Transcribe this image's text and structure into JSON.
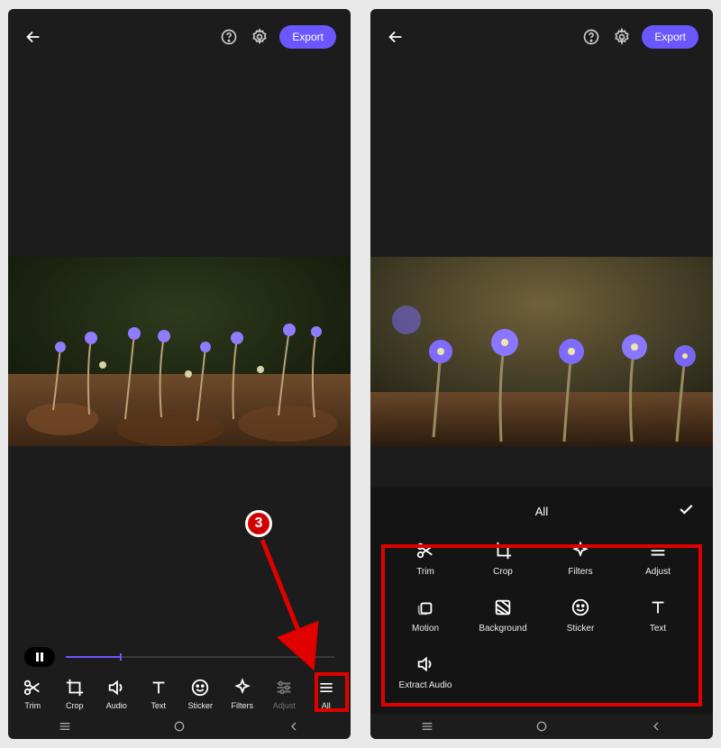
{
  "header": {
    "export_label": "Export"
  },
  "left": {
    "tools": [
      {
        "name": "trim",
        "label": "Trim"
      },
      {
        "name": "crop",
        "label": "Crop"
      },
      {
        "name": "audio",
        "label": "Audio"
      },
      {
        "name": "text",
        "label": "Text"
      },
      {
        "name": "sticker",
        "label": "Sticker"
      },
      {
        "name": "filters",
        "label": "Filters"
      },
      {
        "name": "adjust",
        "label": "Adjust"
      },
      {
        "name": "all",
        "label": "All"
      }
    ]
  },
  "right": {
    "panel_title": "All",
    "panel_items": [
      {
        "name": "trim",
        "label": "Trim"
      },
      {
        "name": "crop",
        "label": "Crop"
      },
      {
        "name": "filters",
        "label": "Filters"
      },
      {
        "name": "adjust",
        "label": "Adjust"
      },
      {
        "name": "motion",
        "label": "Motion"
      },
      {
        "name": "background",
        "label": "Background"
      },
      {
        "name": "sticker",
        "label": "Sticker"
      },
      {
        "name": "text",
        "label": "Text"
      },
      {
        "name": "extract-audio",
        "label": "Extract Audio"
      }
    ]
  },
  "annotation": {
    "step_number": "3"
  },
  "colors": {
    "accent": "#6b57ff",
    "annotation_red": "#e00000"
  }
}
